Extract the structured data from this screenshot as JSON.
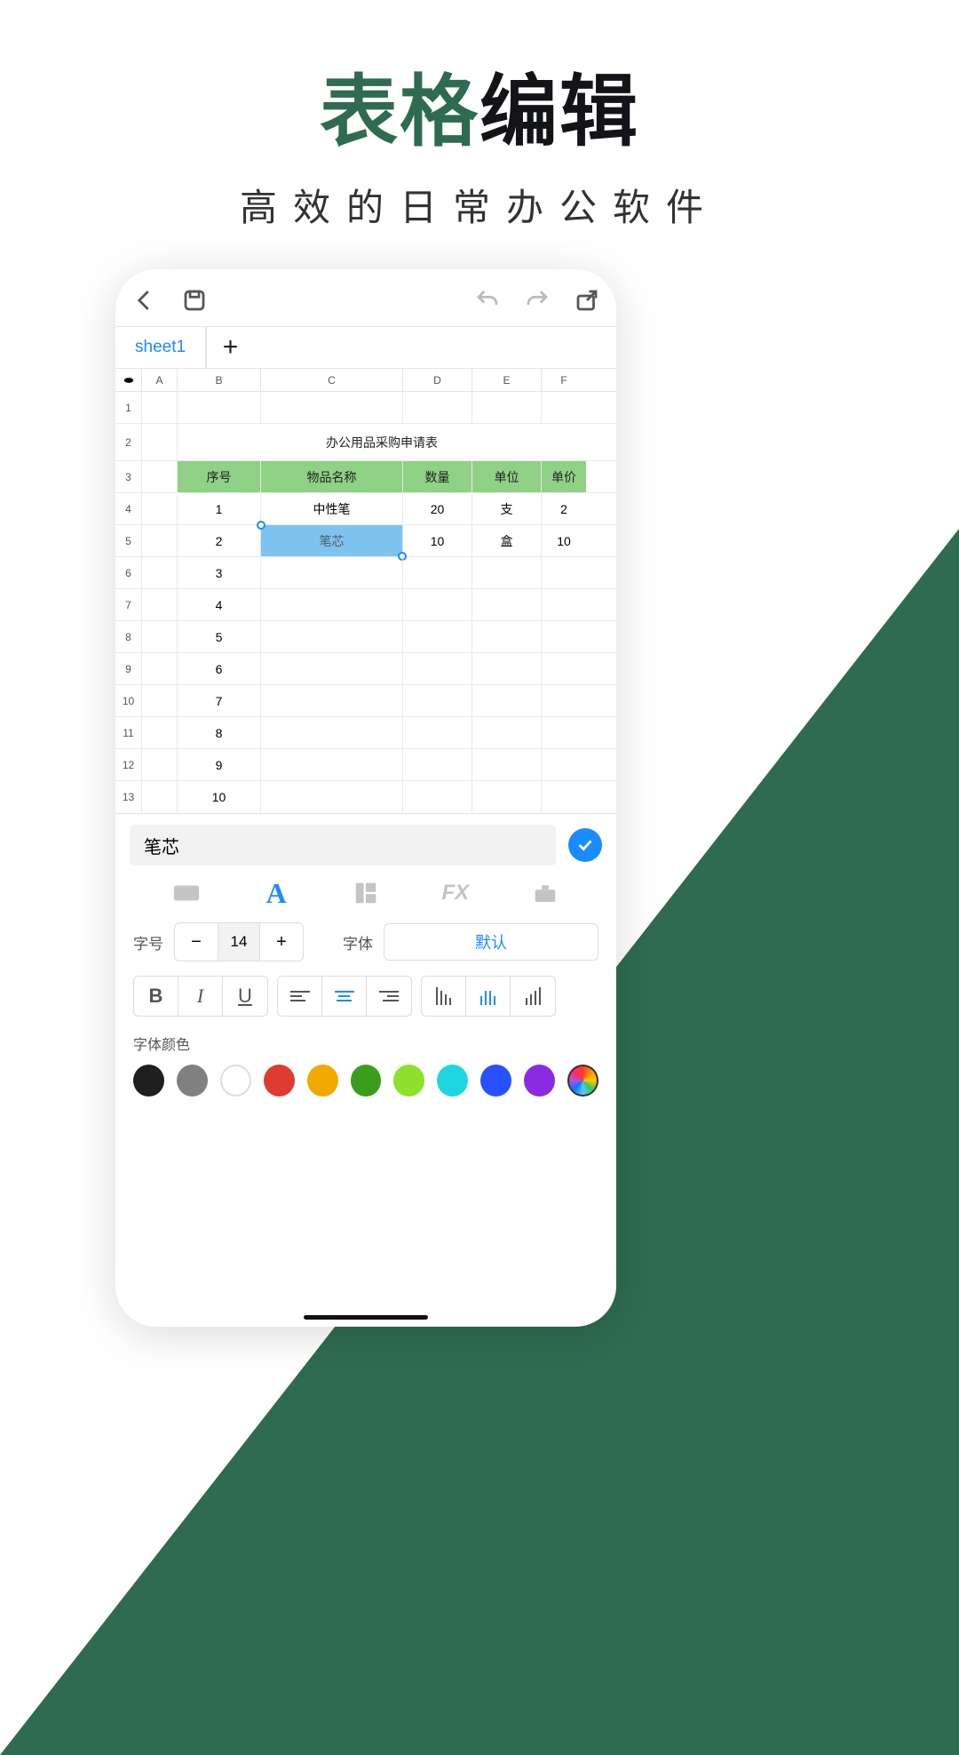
{
  "promo": {
    "title_green": "表格",
    "title_black": "编辑",
    "subtitle": "高效的日常办公软件"
  },
  "tabs": {
    "active": "sheet1"
  },
  "columns": [
    "A",
    "B",
    "C",
    "D",
    "E",
    "F"
  ],
  "merged_title": "办公用品采购申请表",
  "headers": [
    "序号",
    "物品名称",
    "数量",
    "单位",
    "单价"
  ],
  "rows": [
    {
      "n": "1",
      "name": "中性笔",
      "qty": "20",
      "unit": "支",
      "price": "2"
    },
    {
      "n": "2",
      "name": "笔芯",
      "qty": "10",
      "unit": "盒",
      "price": "10"
    },
    {
      "n": "3"
    },
    {
      "n": "4"
    },
    {
      "n": "5"
    },
    {
      "n": "6"
    },
    {
      "n": "7"
    },
    {
      "n": "8"
    },
    {
      "n": "9"
    },
    {
      "n": "10"
    }
  ],
  "row_numbers": [
    "1",
    "2",
    "3",
    "4",
    "5",
    "6",
    "7",
    "8",
    "9",
    "10",
    "11",
    "12",
    "13"
  ],
  "selected_cell": {
    "row": 5,
    "col": "C"
  },
  "edit_value": "笔芯",
  "panel": {
    "font_size_label": "字号",
    "font_size_value": "14",
    "font_family_label": "字体",
    "font_family_value": "默认",
    "color_label": "字体颜色",
    "colors": [
      "#1f1f1f",
      "#808080",
      "#ffffff",
      "#e03b2f",
      "#f2a900",
      "#3a9e1b",
      "#8de02c",
      "#1fd6e0",
      "#2850ff",
      "#8a2be2"
    ]
  }
}
